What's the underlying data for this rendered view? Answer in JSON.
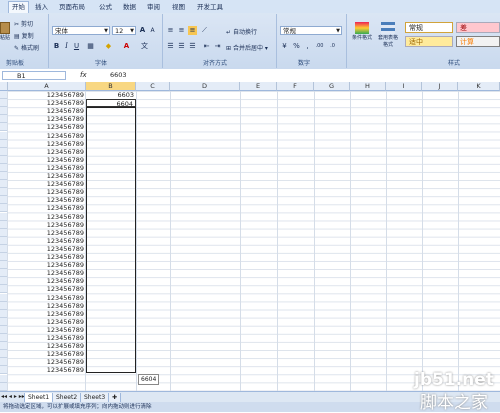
{
  "ribbon": {
    "tabs": [
      "开始",
      "插入",
      "页面布局",
      "公式",
      "数据",
      "审阅",
      "视图",
      "开发工具"
    ],
    "groups": [
      "剪贴板",
      "字体",
      "对齐方式",
      "数字",
      "样式"
    ],
    "clipboard": {
      "paste": "粘贴",
      "cut": "剪切",
      "copy": "复制",
      "format_painter": "格式刷"
    },
    "font": {
      "name": "宋体",
      "size": "12"
    },
    "alignment": {
      "wrap": "自动换行",
      "merge": "合并后居中"
    },
    "number": {
      "format": "常规"
    },
    "styles": {
      "normal": "常规",
      "bad": "差",
      "good": "适中",
      "calc": "计算",
      "conditional": "条件格式",
      "table": "套用表格格式"
    }
  },
  "formula_bar": {
    "name_box": "B1",
    "fx": "fx",
    "value": "6603"
  },
  "columns": [
    "A",
    "B",
    "C",
    "D",
    "E",
    "F",
    "G",
    "H",
    "I",
    "J",
    "K"
  ],
  "cells": {
    "col_a_value": "123456789",
    "b1": "6603",
    "b2": "6604"
  },
  "autofill_tooltip": "6604",
  "sheets": [
    "Sheet1",
    "Sheet2",
    "Sheet3"
  ],
  "status_text": "将拖动选定区域，可以扩展或填充序列；向内拖动则进行清除",
  "watermark": {
    "line1": "jb51.net",
    "line2": "脚本之家"
  },
  "colors": {
    "ribbon_bg": "#c9d9ee",
    "selected_header": "#f8d782",
    "bad_fill": "#ffc7ce",
    "good_fill": "#ffeb9c",
    "calc_fill": "#f2f2f2"
  }
}
